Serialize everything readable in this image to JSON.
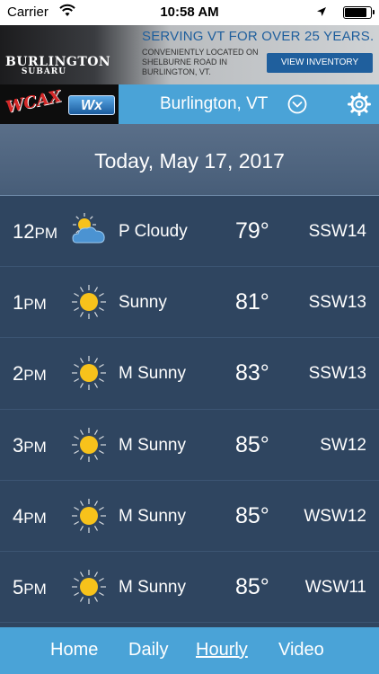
{
  "status_bar": {
    "carrier": "Carrier",
    "time": "10:58 AM",
    "wifi_icon": "wifi-icon",
    "location_icon": "location-arrow-icon",
    "battery_icon": "battery-icon",
    "battery_level": 0.9
  },
  "ad": {
    "brand_line1": "BURLINGTON",
    "brand_line2": "SUBARU",
    "headline": "SERVING VT FOR OVER 25 YEARS.",
    "subtext": "CONVENIENTLY LOCATED ON SHELBURNE ROAD IN BURLINGTON, VT.",
    "button_label": "VIEW INVENTORY",
    "accent_color": "#1f5f9d"
  },
  "header": {
    "logo_text": "WCAX",
    "logo_wx": "Wx",
    "location": "Burlington, VT",
    "chevron_icon": "chevron-down-circle-icon",
    "settings_icon": "gear-icon",
    "background_color": "#4aa3d7"
  },
  "date_title": "Today, May 17, 2017",
  "hours": [
    {
      "hour": "12",
      "ampm": "PM",
      "icon": "partly-cloudy-icon",
      "condition": "P Cloudy",
      "temp": "79°",
      "wind": "SSW14"
    },
    {
      "hour": "1",
      "ampm": "PM",
      "icon": "sun-icon",
      "condition": "Sunny",
      "temp": "81°",
      "wind": "SSW13"
    },
    {
      "hour": "2",
      "ampm": "PM",
      "icon": "sun-icon",
      "condition": "M Sunny",
      "temp": "83°",
      "wind": "SSW13"
    },
    {
      "hour": "3",
      "ampm": "PM",
      "icon": "sun-icon",
      "condition": "M Sunny",
      "temp": "85°",
      "wind": "SW12"
    },
    {
      "hour": "4",
      "ampm": "PM",
      "icon": "sun-icon",
      "condition": "M Sunny",
      "temp": "85°",
      "wind": "WSW12"
    },
    {
      "hour": "5",
      "ampm": "PM",
      "icon": "sun-icon",
      "condition": "M Sunny",
      "temp": "85°",
      "wind": "WSW11"
    }
  ],
  "tabs": [
    {
      "label": "Home",
      "active": false
    },
    {
      "label": "Daily",
      "active": false
    },
    {
      "label": "Hourly",
      "active": true
    },
    {
      "label": "Video",
      "active": false
    }
  ],
  "colors": {
    "row_background": "#2f4560",
    "sun_yellow": "#f7c21b",
    "tab_bar": "#4aa3d7"
  }
}
